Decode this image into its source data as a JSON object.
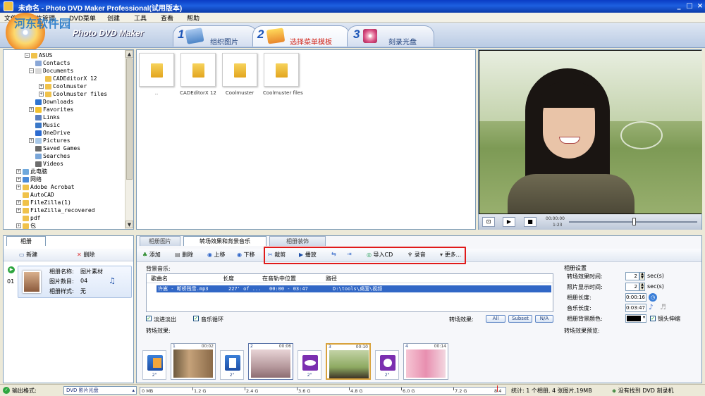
{
  "window": {
    "title": "未命名 - Photo DVD Maker Professional(试用版本)",
    "controls": {
      "min": "_",
      "max": "□",
      "close": "×"
    }
  },
  "menu": [
    "文件",
    "照片管理",
    "DVD菜单",
    "创建",
    "工具",
    "查看",
    "帮助"
  ],
  "watermark": "河东软件园",
  "banner": {
    "logo": "Photo DVD Maker",
    "steps": [
      {
        "num": "1",
        "label": "组织图片"
      },
      {
        "num": "2",
        "label": "选择菜单模板"
      },
      {
        "num": "3",
        "label": "刻录光盘"
      }
    ]
  },
  "tree": {
    "items": [
      {
        "label": "ASUS",
        "expander": "−",
        "icon": "folder"
      },
      {
        "label": "Contacts",
        "expander": "",
        "icon": "contacts"
      },
      {
        "label": "Documents",
        "expander": "−",
        "icon": "documents"
      },
      {
        "label": "CADEditorX 12",
        "expander": "",
        "icon": "folder"
      },
      {
        "label": "Coolmuster",
        "expander": "+",
        "icon": "folder"
      },
      {
        "label": "Coolmuster files",
        "expander": "+",
        "icon": "folder"
      },
      {
        "label": "Downloads",
        "expander": "",
        "icon": "downloads"
      },
      {
        "label": "Favorites",
        "expander": "+",
        "icon": "favorites"
      },
      {
        "label": "Links",
        "expander": "",
        "icon": "links"
      },
      {
        "label": "Music",
        "expander": "",
        "icon": "music"
      },
      {
        "label": "OneDrive",
        "expander": "",
        "icon": "onedrive"
      },
      {
        "label": "Pictures",
        "expander": "+",
        "icon": "pictures"
      },
      {
        "label": "Saved Games",
        "expander": "",
        "icon": "games"
      },
      {
        "label": "Searches",
        "expander": "",
        "icon": "search"
      },
      {
        "label": "Videos",
        "expander": "",
        "icon": "videos"
      },
      {
        "label": "此电脑",
        "expander": "+",
        "icon": "computer"
      },
      {
        "label": "网络",
        "expander": "+",
        "icon": "network"
      },
      {
        "label": "Adobe Acrobat",
        "expander": "+",
        "icon": "folder"
      },
      {
        "label": "AutoCAD",
        "expander": "",
        "icon": "folder"
      },
      {
        "label": "FileZilla(1)",
        "expander": "+",
        "icon": "folder"
      },
      {
        "label": "FileZilla_recovered",
        "expander": "+",
        "icon": "folder"
      },
      {
        "label": "pdf",
        "expander": "",
        "icon": "folder"
      },
      {
        "label": "包",
        "expander": "+",
        "icon": "folder"
      }
    ]
  },
  "files": [
    {
      "name": ".."
    },
    {
      "name": "CADEditorX 12"
    },
    {
      "name": "Coolmuster"
    },
    {
      "name": "Coolmuster files"
    }
  ],
  "player": {
    "time": "00:00:00",
    "total": "1:23",
    "buttons": [
      "select",
      "play",
      "stop"
    ]
  },
  "album_panel": {
    "tab": "相册",
    "new_label": "新建",
    "delete_label": "删除",
    "item": {
      "index": "01",
      "name_label": "相册名称:",
      "name_value": "图片素材",
      "count_label": "图片数目:",
      "count_value": "04",
      "style_label": "相册样式:",
      "style_value": "无"
    }
  },
  "main_tabs": [
    "相册图片",
    "转场效果和背景音乐",
    "相册装饰"
  ],
  "toolbar": {
    "add": "添加",
    "delete": "删除",
    "up": "上移",
    "down": "下移",
    "crop": "裁剪",
    "play": "播放",
    "import_cd": "导入CD",
    "record": "录音",
    "more": "更多..."
  },
  "music": {
    "section_label": "背景音乐:",
    "columns": [
      "歌曲名",
      "长度",
      "在音轨中位置",
      "路径"
    ],
    "rows": [
      {
        "name": "许嵩 - 断桥残雪.mp3",
        "length": "227' of ...",
        "position": "00:00 - 03:47",
        "path": "D:\\tools\\桌面\\视频"
      }
    ],
    "fade_label": "淡进淡出",
    "loop_label": "音乐循环",
    "effects_label": "转场效果:",
    "filter_all": "All",
    "filter_subset": "Subset",
    "filter_na": "N/A"
  },
  "transitions": {
    "label": "转场效果:",
    "slides": [
      {
        "num": "1",
        "time": "00:02"
      },
      {
        "num": "2",
        "time": "00:06"
      },
      {
        "num": "3",
        "time": "00:10"
      },
      {
        "num": "4",
        "time": "00:14"
      }
    ],
    "trans_label": "2\""
  },
  "settings": {
    "title": "相册设置",
    "transition_time_label": "转场效果时间:",
    "transition_time": "2",
    "transition_unit": "sec(s)",
    "photo_time_label": "照片显示时间:",
    "photo_time": "2",
    "photo_unit": "sec(s)",
    "album_length_label": "相册长度:",
    "album_length": "0:00:16",
    "music_length_label": "音乐长度:",
    "music_length": "0:03:47",
    "bg_color_label": "相册背景颜色:",
    "bg_color": "#000000",
    "pan_zoom_label": "镜头伸缩",
    "preview_label": "转场效果预览:"
  },
  "status": {
    "output_label": "输出格式:",
    "output_value": "DVD 影片光盘",
    "ticks": [
      "0 MB",
      "1.2 G",
      "2.4 G",
      "3.6 G",
      "4.8 G",
      "6.0 G",
      "7.2 G",
      "8.4 G"
    ],
    "stats": "统计: 1 个相册, 4 张图片,19MB",
    "burner": "没有找到 DVD 刻录机"
  },
  "colors": {
    "titlebar": "#0a3cc4",
    "highlight": "#e01a1a",
    "selection": "#3167c6"
  }
}
